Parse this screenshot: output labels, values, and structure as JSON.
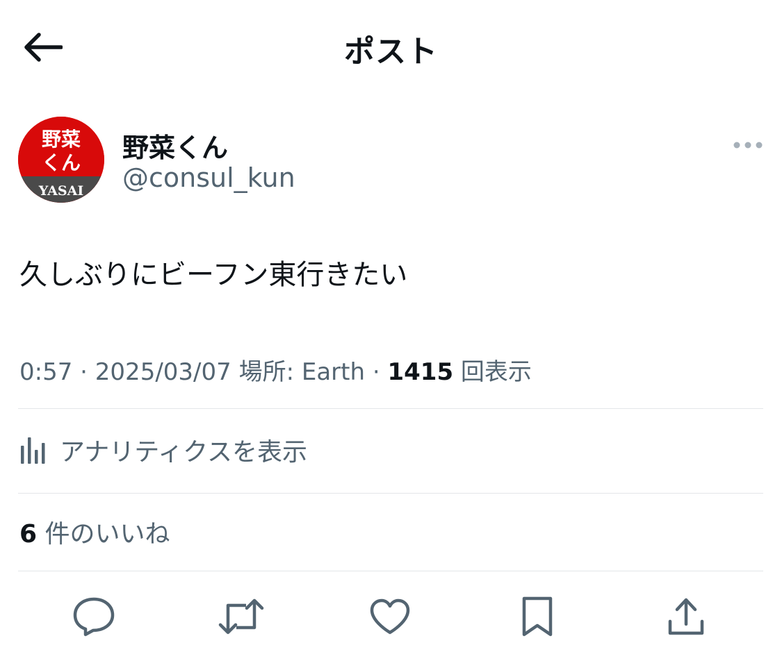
{
  "header": {
    "title": "ポスト",
    "back_icon": "arrow-left-icon"
  },
  "author": {
    "display_name": "野菜くん",
    "handle": "@consul_kun",
    "avatar": {
      "line1": "野菜",
      "line2": "くん",
      "band": "YASAI",
      "bg_color": "#d80a0a",
      "band_color": "#4a4a4a"
    },
    "more_icon": "more-horizontal-icon"
  },
  "post": {
    "text": "久しぶりにビーフン東行きたい",
    "time": "0:57",
    "date": "2025/03/07",
    "location_prefix": "場所: Earth",
    "view_count": "1415",
    "view_suffix": "回表示"
  },
  "analytics": {
    "label": "アナリティクスを表示",
    "icon": "analytics-bars-icon"
  },
  "likes": {
    "count": "6",
    "suffix": "件のいいね"
  },
  "actions": [
    {
      "name": "reply",
      "icon": "reply-icon"
    },
    {
      "name": "repost",
      "icon": "repost-icon"
    },
    {
      "name": "like",
      "icon": "heart-icon"
    },
    {
      "name": "bookmark",
      "icon": "bookmark-icon"
    },
    {
      "name": "share",
      "icon": "share-icon"
    }
  ],
  "colors": {
    "text_primary": "#0f1419",
    "text_secondary": "#536471",
    "divider": "#e3e6e9"
  }
}
